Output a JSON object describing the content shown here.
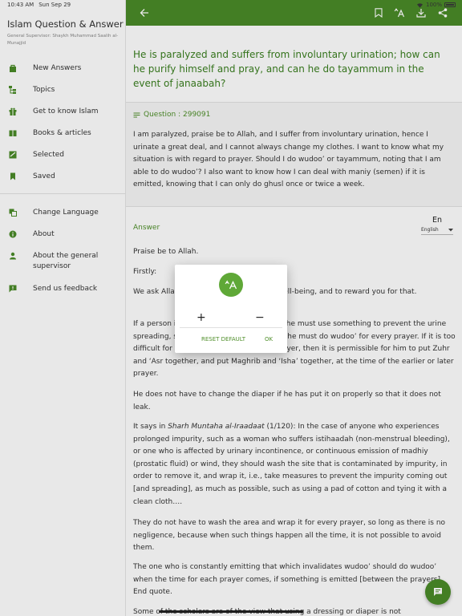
{
  "status_bar": {
    "time": "10:43 AM",
    "date": "Sun Sep 29",
    "battery": "100%"
  },
  "sidebar": {
    "title": "Islam Question & Answer",
    "subtitle": "General Supervisor: Shaykh Muhammad Saalih al-Munajjid",
    "items": [
      {
        "label": "New Answers",
        "icon": "bag-icon"
      },
      {
        "label": "Topics",
        "icon": "topics-icon"
      },
      {
        "label": "Get to know Islam",
        "icon": "gift-icon"
      },
      {
        "label": "Books & articles",
        "icon": "book-icon"
      },
      {
        "label": "Selected",
        "icon": "selected-icon"
      },
      {
        "label": "Saved",
        "icon": "bookmark-icon"
      }
    ],
    "items2": [
      {
        "label": "Change Language",
        "icon": "translate-icon"
      },
      {
        "label": "About",
        "icon": "info-icon"
      },
      {
        "label": "About the general supervisor",
        "icon": "person-icon"
      },
      {
        "label": "Send us feedback",
        "icon": "feedback-icon"
      }
    ]
  },
  "content": {
    "question_title": "He is paralyzed and suffers from involuntary urination; how can he purify himself and pray, and can he do tayammum in the event of janaabah?",
    "question_label": "Question : 299091",
    "question_text": "I am paralyzed, praise be to Allah, and I suffer from involuntary urination, hence I urinate a great deal, and I cannot always change my clothes. I want to know what my situation is with regard to prayer. Should I do wudoo’ or tayammum, noting that I am able to do wudoo’? I also want to know how I can deal with maniy (semen) if it is emitted, knowing that I can only do ghusl once or twice a week.",
    "answer_label": "Answer",
    "language_short": "En",
    "language_name": "English",
    "paragraphs": {
      "p1": "Praise be to Allah.",
      "p2": "Firstly:",
      "p3": "We ask Allah to heal you and grant you well-being, and to reward you for that.",
      "p4": "If a person is suffering from incontinence, he must use something to prevent the urine spreading, such as wearing a diaper, then he must do wudoo’ for every prayer. If it is too difficult for him to do wudoo’ for every prayer, then it is permissible for him to put Zuhr and ‘Asr together, and put Maghrib and ‘Isha’ together, at the time of the earlier or later prayer.",
      "p5": "He does not have to change the diaper if he has put it on properly so that it does not leak.",
      "p6a": "It says in ",
      "p6b": "Sharh Muntaha al-Iraadaat",
      "p6c": " (1/120): In the case of anyone who experiences prolonged impurity, such as a woman who suffers istihaadah (non-menstrual bleeding), or one who is affected by urinary incontinence, or continuous emission of madhiy (prostatic fluid) or wind, they should wash the site that is contaminated by impurity, in order to remove it, and wrap it, i.e., take measures to prevent the impurity coming out [and spreading], as much as possible, such as using a pad of cotton and tying it with a clean cloth….",
      "p7": "They do not have to wash the area and wrap it for every prayer, so long as there is no negligence, because when such things happen all the time, it is not possible to avoid them.",
      "p8": "The one who is constantly emitting that which invalidates wudoo’ should do wudoo’ when the time for each prayer comes, if something is emitted [between the prayers]. End quote.",
      "p9": "Some of the scholars are of the view that using a dressing or diaper is not"
    }
  },
  "dialog": {
    "plus": "+",
    "minus": "−",
    "reset": "RESET DEFAULT",
    "ok": "OK"
  },
  "colors": {
    "primary": "#4a8b28",
    "accent": "#5fa837"
  }
}
